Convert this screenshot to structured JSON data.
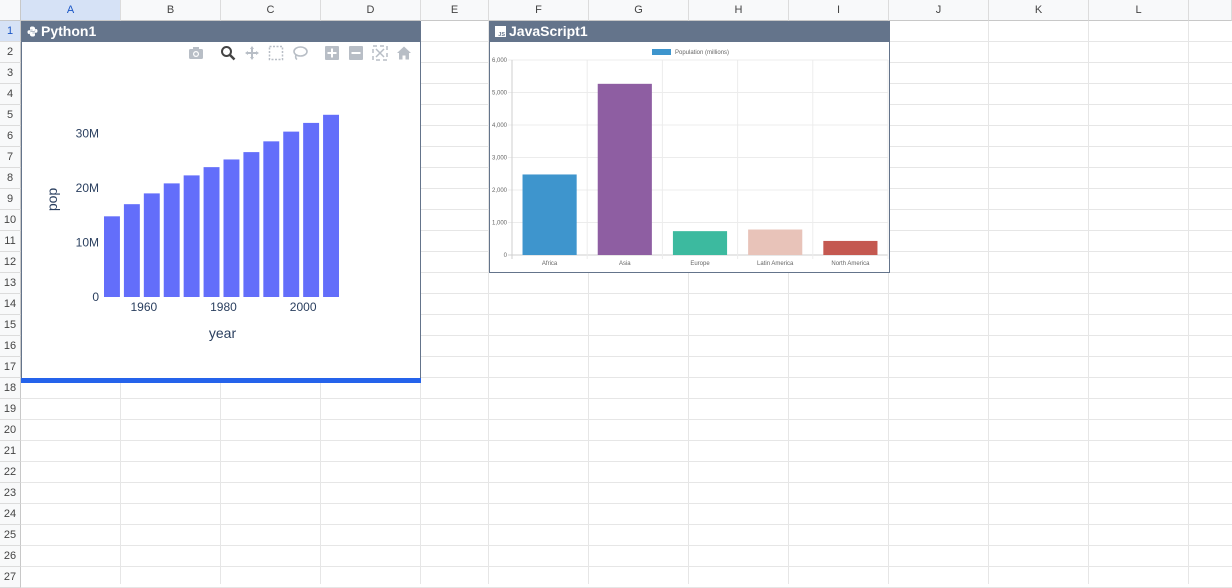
{
  "columns": [
    "A",
    "B",
    "C",
    "D",
    "E",
    "F",
    "G",
    "H",
    "I",
    "J",
    "K",
    "L"
  ],
  "rows": [
    "1",
    "2",
    "3",
    "4",
    "5",
    "6",
    "7",
    "8",
    "9",
    "10",
    "11",
    "12",
    "13",
    "14",
    "15",
    "16",
    "17",
    "18",
    "19",
    "20",
    "21",
    "22",
    "23",
    "24",
    "25",
    "26",
    "27"
  ],
  "selected_column": "A",
  "selected_row": "1",
  "python_panel": {
    "title": "Python1",
    "modebar": [
      "camera-icon",
      "zoom-icon",
      "pan-icon",
      "box-select-icon",
      "lasso-icon",
      "zoom-in-icon",
      "zoom-out-icon",
      "autoscale-icon",
      "reset-axes-icon"
    ],
    "accent_color": "#2563eb"
  },
  "javascript_panel": {
    "title": "JavaScript1"
  },
  "chart_data": [
    {
      "type": "bar",
      "x": [
        1952,
        1957,
        1962,
        1967,
        1972,
        1977,
        1982,
        1987,
        1992,
        1997,
        2002,
        2007
      ],
      "values": [
        14785584,
        17010154,
        18985849,
        20819767,
        22284500,
        23796400,
        25201900,
        26549700,
        28523502,
        30305843,
        31902268,
        33390141
      ],
      "xlabel": "year",
      "ylabel": "pop",
      "xticks": [
        "1960",
        "1980",
        "2000"
      ],
      "yticks": [
        "0",
        "10M",
        "20M",
        "30M"
      ],
      "ylim": [
        0,
        35000000
      ],
      "color": "#636efa",
      "grid": false
    },
    {
      "type": "bar",
      "categories": [
        "Africa",
        "Asia",
        "Europe",
        "Latin America",
        "North America"
      ],
      "values": [
        2478,
        5267,
        734,
        784,
        433
      ],
      "series_name": "Population (millions)",
      "colors": [
        "#3e95cd",
        "#8e5ea2",
        "#3cba9f",
        "#e8c3b9",
        "#c45850"
      ],
      "yticks": [
        "0",
        "1,000",
        "2,000",
        "3,000",
        "4,000",
        "5,000",
        "6,000"
      ],
      "ylim": [
        0,
        6000
      ],
      "legend": "top",
      "grid": true
    }
  ]
}
